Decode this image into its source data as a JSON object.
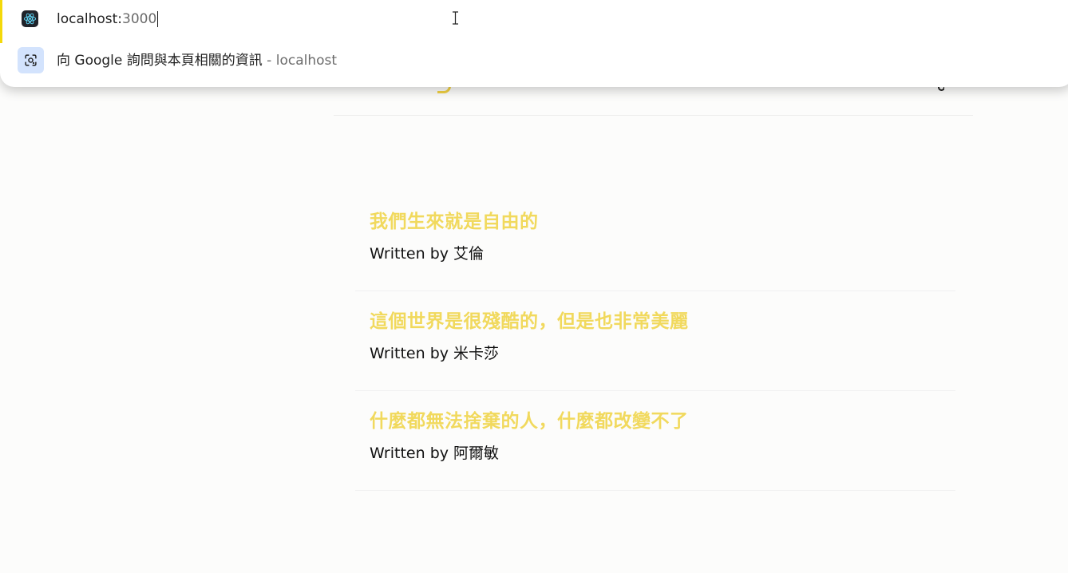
{
  "omnibox": {
    "url_host": "localhost:",
    "url_port": "3000",
    "suggestion": {
      "text": "向 Google 詢問與本頁相關的資訊",
      "separator": " - ",
      "domain": "localhost"
    }
  },
  "blogs": [
    {
      "title": "我們生來就是自由的",
      "author_prefix": "Written by ",
      "author": "艾倫"
    },
    {
      "title": "這個世界是很殘酷的，但是也非常美麗",
      "author_prefix": "Written by ",
      "author": "米卡莎"
    },
    {
      "title": "什麼都無法捨棄的人，什麼都改變不了",
      "author_prefix": "Written by ",
      "author": "阿爾敏"
    }
  ],
  "colors": {
    "title": "#f1d95d",
    "accent": "#f4d90a",
    "suggestion_icon_bg": "#d3e3fd"
  },
  "icons": {
    "favicon": "react-icon",
    "suggestion": "google-lens-icon",
    "mouse": "text-cursor-icon"
  }
}
